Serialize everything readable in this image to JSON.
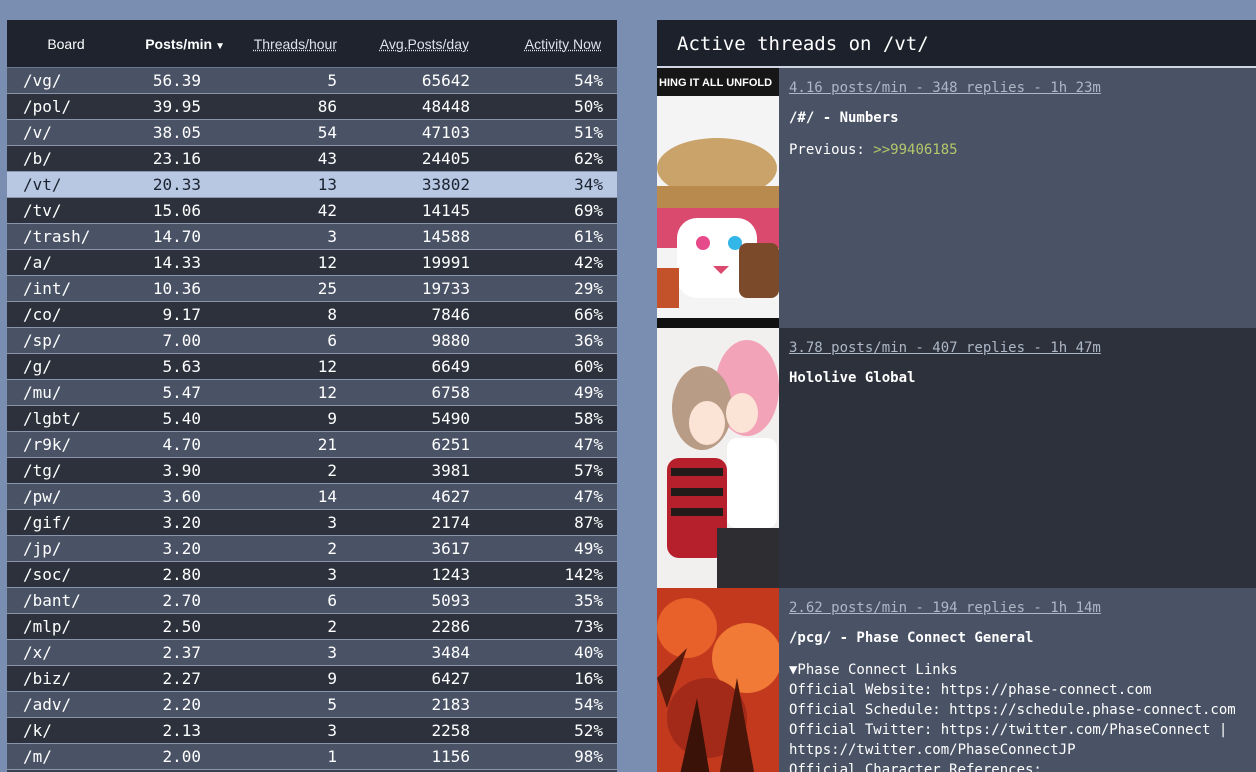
{
  "table": {
    "headers": {
      "board": "Board",
      "posts_min": "Posts/min",
      "threads_hour": "Threads/hour",
      "avg_posts_day": "Avg.Posts/day",
      "activity_now": "Activity Now",
      "sort_caret": "▼"
    },
    "rows": [
      {
        "board": "/vg/",
        "ppm": "56.39",
        "tph": "5",
        "avg": "65642",
        "act": "54%"
      },
      {
        "board": "/pol/",
        "ppm": "39.95",
        "tph": "86",
        "avg": "48448",
        "act": "50%"
      },
      {
        "board": "/v/",
        "ppm": "38.05",
        "tph": "54",
        "avg": "47103",
        "act": "51%"
      },
      {
        "board": "/b/",
        "ppm": "23.16",
        "tph": "43",
        "avg": "24405",
        "act": "62%"
      },
      {
        "board": "/vt/",
        "ppm": "20.33",
        "tph": "13",
        "avg": "33802",
        "act": "34%"
      },
      {
        "board": "/tv/",
        "ppm": "15.06",
        "tph": "42",
        "avg": "14145",
        "act": "69%"
      },
      {
        "board": "/trash/",
        "ppm": "14.70",
        "tph": "3",
        "avg": "14588",
        "act": "61%"
      },
      {
        "board": "/a/",
        "ppm": "14.33",
        "tph": "12",
        "avg": "19991",
        "act": "42%"
      },
      {
        "board": "/int/",
        "ppm": "10.36",
        "tph": "25",
        "avg": "19733",
        "act": "29%"
      },
      {
        "board": "/co/",
        "ppm": "9.17",
        "tph": "8",
        "avg": "7846",
        "act": "66%"
      },
      {
        "board": "/sp/",
        "ppm": "7.00",
        "tph": "6",
        "avg": "9880",
        "act": "36%"
      },
      {
        "board": "/g/",
        "ppm": "5.63",
        "tph": "12",
        "avg": "6649",
        "act": "60%"
      },
      {
        "board": "/mu/",
        "ppm": "5.47",
        "tph": "12",
        "avg": "6758",
        "act": "49%"
      },
      {
        "board": "/lgbt/",
        "ppm": "5.40",
        "tph": "9",
        "avg": "5490",
        "act": "58%"
      },
      {
        "board": "/r9k/",
        "ppm": "4.70",
        "tph": "21",
        "avg": "6251",
        "act": "47%"
      },
      {
        "board": "/tg/",
        "ppm": "3.90",
        "tph": "2",
        "avg": "3981",
        "act": "57%"
      },
      {
        "board": "/pw/",
        "ppm": "3.60",
        "tph": "14",
        "avg": "4627",
        "act": "47%"
      },
      {
        "board": "/gif/",
        "ppm": "3.20",
        "tph": "3",
        "avg": "2174",
        "act": "87%"
      },
      {
        "board": "/jp/",
        "ppm": "3.20",
        "tph": "2",
        "avg": "3617",
        "act": "49%"
      },
      {
        "board": "/soc/",
        "ppm": "2.80",
        "tph": "3",
        "avg": "1243",
        "act": "142%"
      },
      {
        "board": "/bant/",
        "ppm": "2.70",
        "tph": "6",
        "avg": "5093",
        "act": "35%"
      },
      {
        "board": "/mlp/",
        "ppm": "2.50",
        "tph": "2",
        "avg": "2286",
        "act": "73%"
      },
      {
        "board": "/x/",
        "ppm": "2.37",
        "tph": "3",
        "avg": "3484",
        "act": "40%"
      },
      {
        "board": "/biz/",
        "ppm": "2.27",
        "tph": "9",
        "avg": "6427",
        "act": "16%"
      },
      {
        "board": "/adv/",
        "ppm": "2.20",
        "tph": "5",
        "avg": "2183",
        "act": "54%"
      },
      {
        "board": "/k/",
        "ppm": "2.13",
        "tph": "3",
        "avg": "2258",
        "act": "52%"
      },
      {
        "board": "/m/",
        "ppm": "2.00",
        "tph": "1",
        "avg": "1156",
        "act": "98%"
      }
    ],
    "selected_board": "/vt/"
  },
  "threads_panel": {
    "title": "Active threads on /vt/",
    "threads": [
      {
        "meta": "4.16 posts/min - 348 replies - 1h 23m",
        "title": "/#/ - Numbers",
        "thumb_caption": "HING IT ALL UNFOLD",
        "body_prefix": "Previous: ",
        "quote": ">>99406185"
      },
      {
        "meta": "3.78 posts/min - 407 replies - 1h 47m",
        "title": "Hololive Global"
      },
      {
        "meta": "2.62 posts/min - 194 replies - 1h 14m",
        "title": "/pcg/ - Phase Connect General",
        "lines": [
          "▼Phase Connect Links",
          "Official Website: https://phase-connect.com",
          "Official Schedule: https://schedule.phase-connect.com",
          "Official Twitter: https://twitter.com/PhaseConnect |",
          "https://twitter.com/PhaseConnectJP",
          "Official Character References:"
        ]
      }
    ]
  }
}
